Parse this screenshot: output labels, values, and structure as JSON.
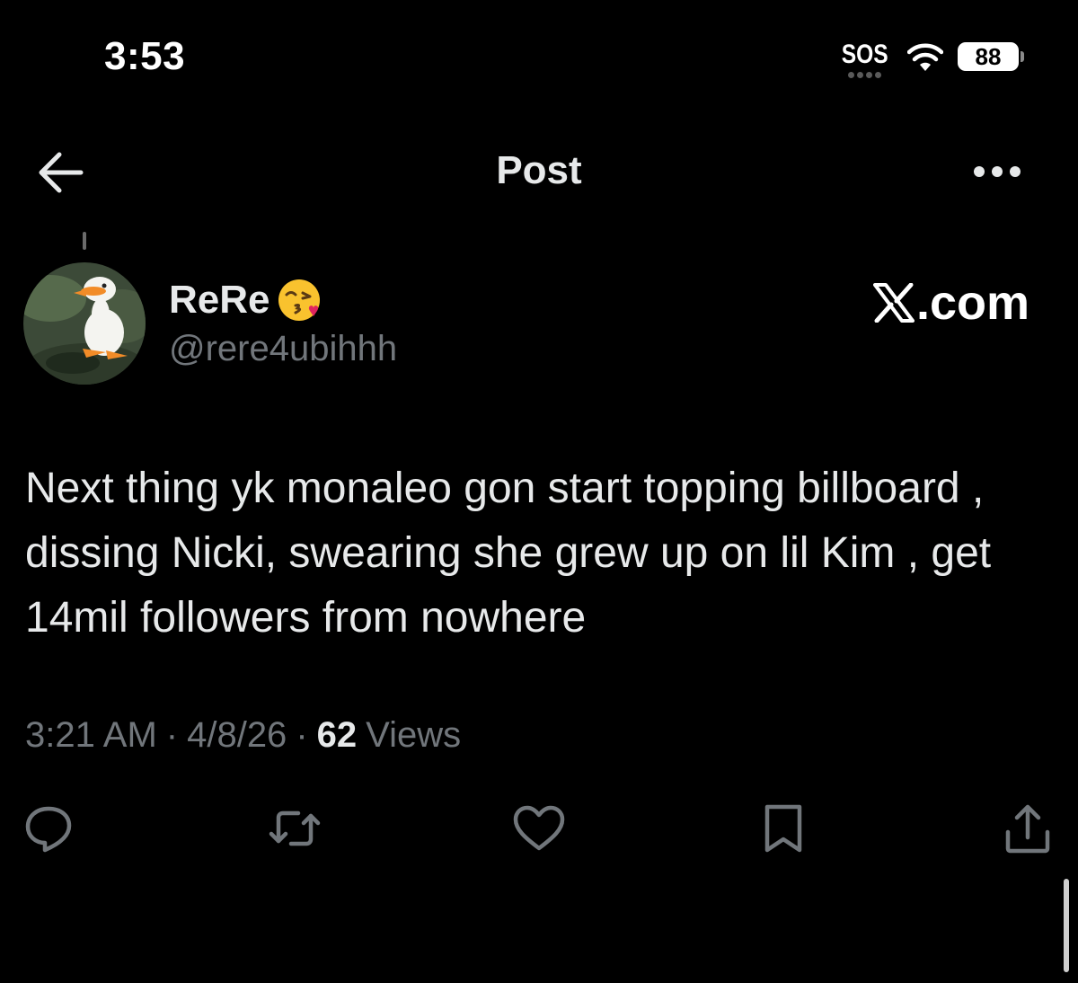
{
  "status_bar": {
    "time": "3:53",
    "sos": "SOS",
    "battery": "88"
  },
  "header": {
    "title": "Post",
    "back_icon": "arrow-left-icon",
    "more_icon": "more-horizontal-icon"
  },
  "author": {
    "display_name": "ReRe",
    "emoji": "face-blowing-kiss-icon",
    "handle": "@rere4ubihhh"
  },
  "watermark": {
    "logo_icon": "x-logo-icon",
    "text": ".com"
  },
  "post": {
    "text": "Next thing yk monaleo gon start topping billboard , dissing Nicki, swearing she grew up on lil Kim , get 14mil followers from nowhere",
    "time": "3:21 AM",
    "date": "4/8/26",
    "views_count": "62",
    "views_label": "Views",
    "separator": "·"
  },
  "actions": [
    {
      "icon": "reply-icon"
    },
    {
      "icon": "repost-icon"
    },
    {
      "icon": "like-icon"
    },
    {
      "icon": "bookmark-icon"
    },
    {
      "icon": "share-icon"
    }
  ],
  "colors": {
    "background": "#000000",
    "text_primary": "#e7e9ea",
    "text_secondary": "#71767b",
    "icon": "#71767b"
  }
}
